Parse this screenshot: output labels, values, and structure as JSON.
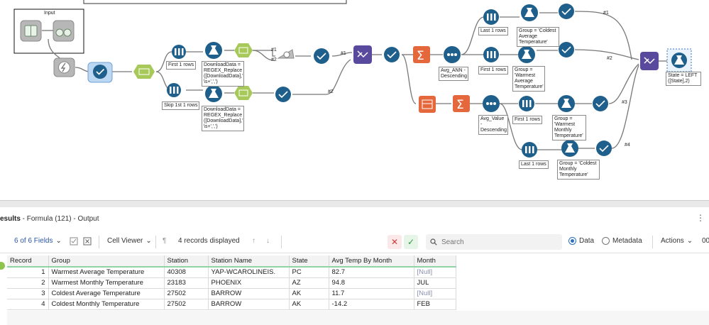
{
  "canvas": {
    "container_title": "Input",
    "labels": {
      "first_rows_a": "First 1 rows",
      "skip_rows": "Skip 1st 1 rows",
      "formula_a": "DownloadData =\nREGEX_Replace\n([DownloadData],'\n\\s+',',')",
      "formula_b": "DownloadData =\nREGEX_Replace\n([DownloadData],'\n\\s+',',')",
      "last_rows_a": "Last 1 rows",
      "group_coldest_avg": "Group = 'Coldest\nAverage\nTemperature'",
      "first_rows_b": "First 1 rows",
      "group_warmest_avg": "Group =\n'Warmest\nAverage\nTemperature'",
      "sort_avg_ann": "Avg_ANN -\nDescending",
      "sort_avg_value": "Avg_Value -\nDescending",
      "first_rows_c": "First 1 rows",
      "group_warmest_monthly": "Group =\n'Warmest\nMonthly\nTemperature'",
      "last_rows_b": "Last 1 rows",
      "group_coldest_monthly": "Group = 'Coldest\nMonthly\nTemperature'",
      "state_formula": "State = LEFT\n([State],2)"
    },
    "connection_labels": {
      "c1": "#1",
      "c2": "#2",
      "u1": "#1",
      "u2": "#2",
      "u3": "#3",
      "u4": "#4",
      "j1": "#1",
      "j2": "#2"
    }
  },
  "results": {
    "title_bold": "esults",
    "title_rest": " - Formula (121) - Output",
    "fields_label": "6 of 6 Fields",
    "cell_viewer": "Cell Viewer",
    "records_displayed": "4 records displayed",
    "search_placeholder": "Search",
    "data_label": "Data",
    "metadata_label": "Metadata",
    "actions_label": "Actions",
    "more_label": "00"
  },
  "table": {
    "headers": [
      "Record",
      "Group",
      "Station",
      "Station Name",
      "State",
      "Avg Temp By Month",
      "Month"
    ],
    "rows": [
      [
        "1",
        "Warmest Average Temperature",
        "40308",
        "YAP-WCAROLINEIS.",
        "PC",
        "82.7",
        "[Null]"
      ],
      [
        "2",
        "Warmest Monthly Temperature",
        "23183",
        "PHOENIX",
        "AZ",
        "94.8",
        "JUL"
      ],
      [
        "3",
        "Coldest Average Temperature",
        "27502",
        "BARROW",
        "AK",
        "11.7",
        "[Null]"
      ],
      [
        "4",
        "Coldest Monthly Temperature",
        "27502",
        "BARROW",
        "AK",
        "-14.2",
        "FEB"
      ]
    ]
  },
  "colors": {
    "tool_blue": "#1f5f8b",
    "tool_green": "#a7c95a",
    "tool_purple": "#5a4a9e",
    "tool_orange": "#e5673c",
    "tool_grey": "#9a9a9a",
    "accent_green": "#8fd4a6",
    "null_text": "#8a8fb0"
  }
}
